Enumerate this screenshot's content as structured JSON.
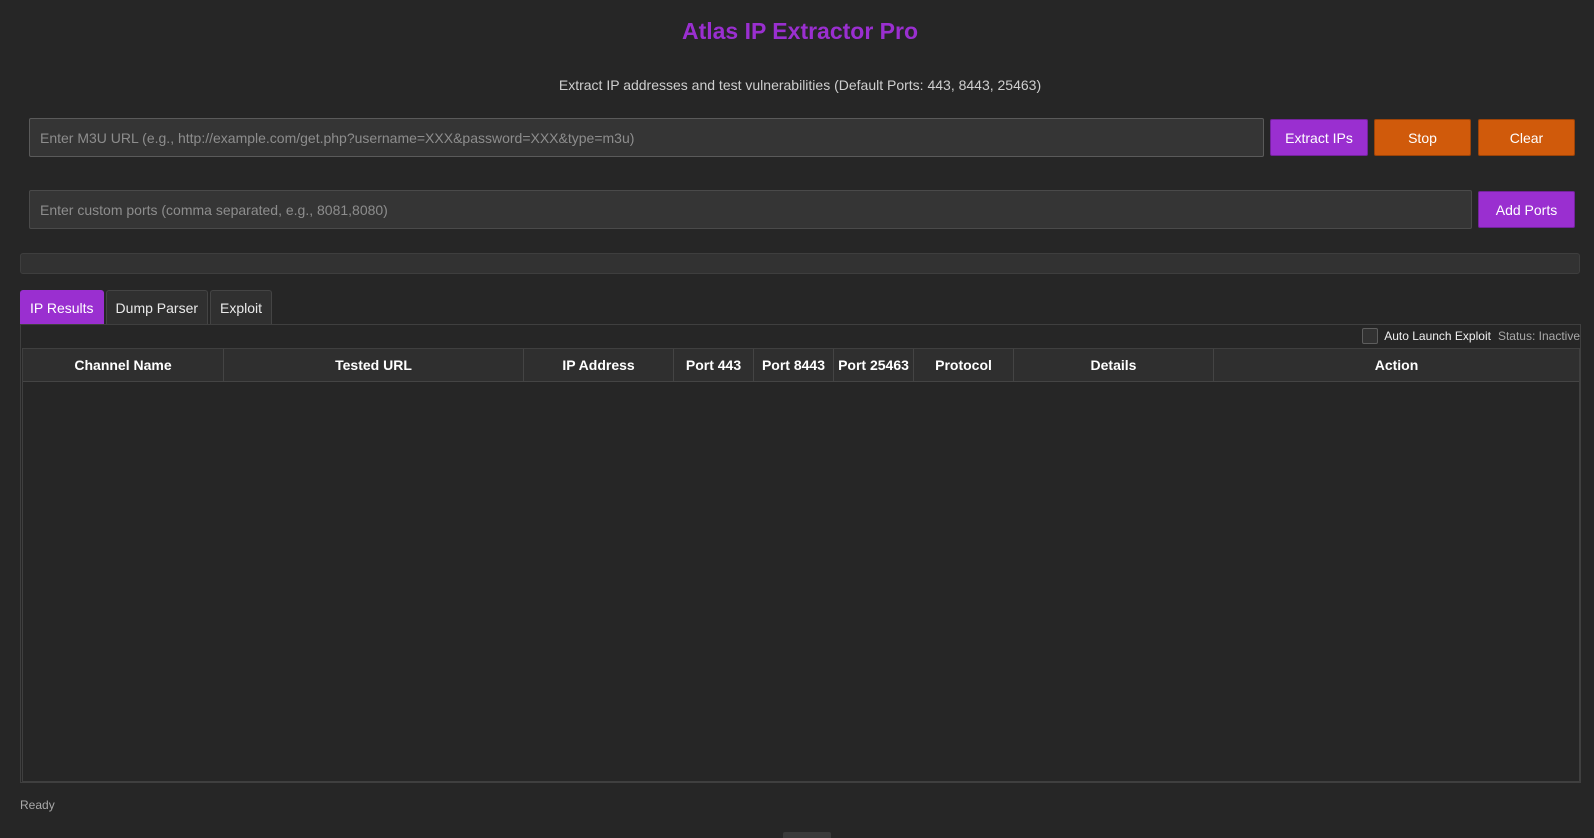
{
  "app": {
    "title": "Atlas IP Extractor Pro",
    "subtitle": "Extract IP addresses and test vulnerabilities (Default Ports: 443, 8443, 25463)"
  },
  "url_input": {
    "value": "",
    "placeholder": "Enter M3U URL (e.g., http://example.com/get.php?username=XXX&password=XXX&type=m3u)"
  },
  "buttons": {
    "extract": "Extract IPs",
    "stop": "Stop",
    "clear": "Clear",
    "add_ports": "Add Ports"
  },
  "ports_input": {
    "value": "",
    "placeholder": "Enter custom ports (comma separated, e.g., 8081,8080)"
  },
  "progress": {
    "value": 0
  },
  "tabs": [
    {
      "label": "IP Results",
      "active": true
    },
    {
      "label": "Dump Parser",
      "active": false
    },
    {
      "label": "Exploit",
      "active": false
    }
  ],
  "auto_launch": {
    "label": "Auto Launch Exploit",
    "checked": false,
    "status": "Status: Inactive"
  },
  "table": {
    "columns": [
      "Channel Name",
      "Tested URL",
      "IP Address",
      "Port 443",
      "Port 8443",
      "Port 25463",
      "Protocol",
      "Details",
      "Action"
    ],
    "rows": []
  },
  "statusbar": {
    "text": "Ready"
  },
  "colors": {
    "accent": "#9a2fd0",
    "warning": "#d05a0b",
    "background": "#262626"
  }
}
